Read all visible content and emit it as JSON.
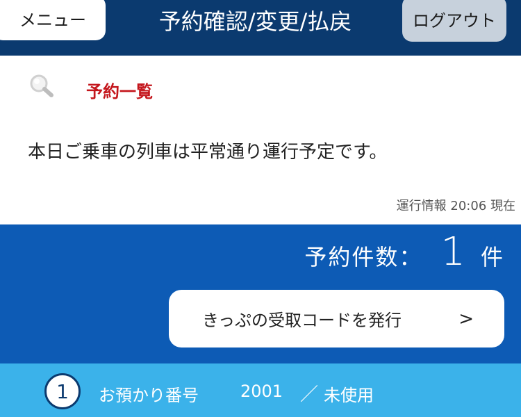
{
  "header": {
    "menu_label": "メニュー",
    "title": "予約確認/変更/払戻",
    "logout_label": "ログアウト"
  },
  "reservations": {
    "section_label": "予約一覧",
    "search_icon": "search-icon",
    "status_message": "本日ご乗車の列車は平常通り運行予定です。",
    "status_time": "運行情報 20:06 現在"
  },
  "count": {
    "label": "予約件数：",
    "value": "1",
    "unit": "件"
  },
  "code_button": {
    "label": "きっぷの受取コードを発行",
    "arrow": ">"
  },
  "items": [
    {
      "index": "1",
      "label": "お預かり番号",
      "number": "2001",
      "separator": "／",
      "status": "未使用"
    }
  ],
  "colors": {
    "header_bg": "#0b3a6f",
    "count_bg": "#0d5bb5",
    "item_bg": "#3bb2ea",
    "section_label": "#c4161c"
  }
}
